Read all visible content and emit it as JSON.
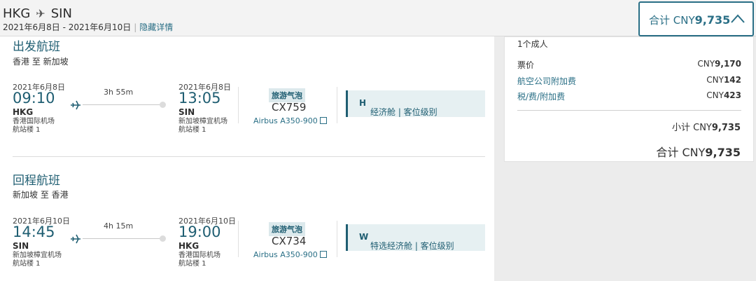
{
  "header": {
    "origin": "HKG",
    "destination": "SIN",
    "date_range": "2021年6月8日 - 2021年6月10日",
    "hide_details_link": "隐藏详情"
  },
  "total_button": {
    "label": "合计 CNY",
    "amount": "9,735"
  },
  "outbound": {
    "title": "出发航班",
    "route": "香港 至 新加坡",
    "dep_date": "2021年6月8日",
    "dep_time": "09:10",
    "dep_code": "HKG",
    "dep_airport": "香港国际机场",
    "dep_terminal": "航站楼 1",
    "duration": "3h 55m",
    "arr_date": "2021年6月8日",
    "arr_time": "13:05",
    "arr_code": "SIN",
    "arr_airport": "新加坡樟宜机场",
    "arr_terminal": "航站楼 1",
    "badge": "旅游气泡",
    "flight_no": "CX759",
    "aircraft": "Airbus A350-900",
    "cabin_label": "经济舱 | 客位级别",
    "cabin_class": "H"
  },
  "return": {
    "title": "回程航班",
    "route": "新加坡 至 香港",
    "dep_date": "2021年6月10日",
    "dep_time": "14:45",
    "dep_code": "SIN",
    "dep_airport": "新加坡樟宜机场",
    "dep_terminal": "航站楼 1",
    "duration": "4h 15m",
    "arr_date": "2021年6月10日",
    "arr_time": "19:00",
    "arr_code": "HKG",
    "arr_airport": "香港国际机场",
    "arr_terminal": "航站楼 1",
    "badge": "旅游气泡",
    "flight_no": "CX734",
    "aircraft": "Airbus A350-900",
    "cabin_label": "特选经济舱 | 客位级别",
    "cabin_class": "W"
  },
  "summary": {
    "passengers": "1个成人",
    "fare_label": "票价",
    "fare_currency": "CNY",
    "fare_value": "9,170",
    "surcharge_label": "航空公司附加费",
    "surcharge_currency": "CNY",
    "surcharge_value": "142",
    "tax_label": "税/费/附加费",
    "tax_currency": "CNY",
    "tax_value": "423",
    "subtotal_label": "小计 CNY",
    "subtotal_value": "9,735",
    "total_label": "合计 CNY",
    "total_value": "9,735"
  },
  "colors": {
    "accent": "#1f5e72",
    "link": "#2a6f86",
    "cabin_bg": "#e6f0f2"
  }
}
